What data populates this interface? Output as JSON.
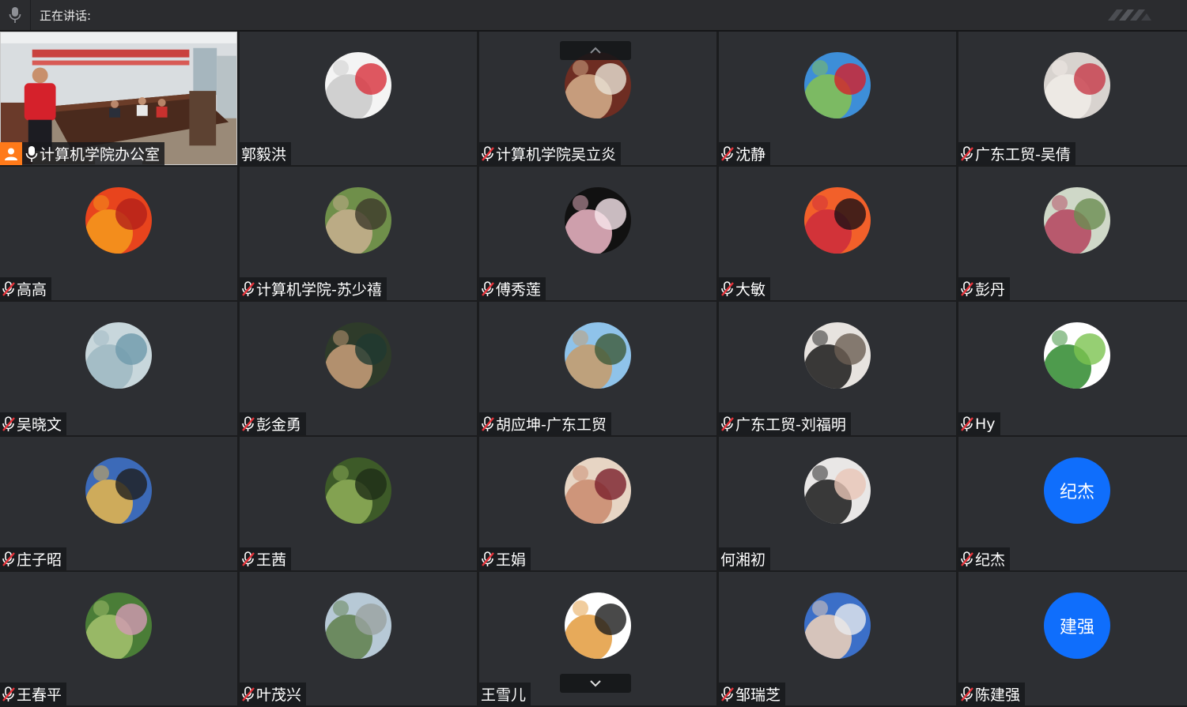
{
  "topbar": {
    "speaking_label": "正在讲话:",
    "mic_icon": "microphone-icon"
  },
  "participants": [
    {
      "name": "计算机学院办公室",
      "type": "video",
      "host": true,
      "mic": "on"
    },
    {
      "name": "郭毅洪",
      "type": "avatar",
      "mic": "none",
      "colors": [
        "#f4f4f4",
        "#c9c9c9",
        "#d8303b"
      ]
    },
    {
      "name": "计算机学院吴立炎",
      "type": "avatar",
      "mic": "muted",
      "colors": [
        "#6e2d22",
        "#d6b08c",
        "#e9e2d6"
      ]
    },
    {
      "name": "沈静",
      "type": "avatar",
      "mic": "muted",
      "colors": [
        "#3d8ed8",
        "#87c24f",
        "#d5202a"
      ]
    },
    {
      "name": "广东工贸-吴倩",
      "type": "avatar",
      "mic": "muted",
      "colors": [
        "#d8d3cf",
        "#f1ece8",
        "#c73a47"
      ]
    },
    {
      "name": "高高",
      "type": "avatar",
      "mic": "muted",
      "colors": [
        "#e8441d",
        "#f59a1c",
        "#b3201a"
      ]
    },
    {
      "name": "计算机学院-苏少禧",
      "type": "avatar",
      "mic": "muted",
      "colors": [
        "#6f8f4a",
        "#c9b08f",
        "#3d3a2a"
      ]
    },
    {
      "name": "傅秀莲",
      "type": "avatar",
      "mic": "muted",
      "colors": [
        "#111111",
        "#f0b8c8",
        "#f7e6ec"
      ]
    },
    {
      "name": "大敏",
      "type": "avatar",
      "mic": "muted",
      "colors": [
        "#f2602a",
        "#cd2b3c",
        "#1b1015"
      ]
    },
    {
      "name": "彭丹",
      "type": "avatar",
      "mic": "muted",
      "colors": [
        "#cfd8c8",
        "#b4435d",
        "#6a8d51"
      ]
    },
    {
      "name": "吴晓文",
      "type": "avatar",
      "mic": "muted",
      "colors": [
        "#c8d7dc",
        "#9eb8c2",
        "#6e9aab"
      ]
    },
    {
      "name": "彭金勇",
      "type": "avatar",
      "mic": "muted",
      "colors": [
        "#2e3b2a",
        "#c9a07a",
        "#1f3a31"
      ]
    },
    {
      "name": "胡应坤-广东工贸",
      "type": "avatar",
      "mic": "muted",
      "colors": [
        "#8fc3ea",
        "#c79b69",
        "#3d5a38"
      ]
    },
    {
      "name": "广东工贸-刘福明",
      "type": "avatar",
      "mic": "muted",
      "colors": [
        "#e7e3df",
        "#1a1a1a",
        "#6b5e52"
      ]
    },
    {
      "name": "Hy",
      "type": "avatar",
      "mic": "muted",
      "colors": [
        "#ffffff",
        "#2f8a2e",
        "#7cc350"
      ]
    },
    {
      "name": "庄子昭",
      "type": "avatar",
      "mic": "muted",
      "colors": [
        "#3c6ab8",
        "#e7b64a",
        "#1e1e1e"
      ]
    },
    {
      "name": "王茜",
      "type": "avatar",
      "mic": "muted",
      "colors": [
        "#3d5a28",
        "#8faf58",
        "#1e2d16"
      ]
    },
    {
      "name": "王娟",
      "type": "avatar",
      "mic": "muted",
      "colors": [
        "#e7d5c4",
        "#c98a6d",
        "#7a1f2c"
      ]
    },
    {
      "name": "何湘初",
      "type": "avatar",
      "mic": "none",
      "colors": [
        "#e9e7e6",
        "#1a1a1a",
        "#e9c6b7"
      ]
    },
    {
      "name": "纪杰",
      "type": "text",
      "avatar_text": "纪杰",
      "mic": "muted"
    },
    {
      "name": "王春平",
      "type": "avatar",
      "mic": "muted",
      "colors": [
        "#4a7d37",
        "#a6c26e",
        "#d39ab4"
      ]
    },
    {
      "name": "叶茂兴",
      "type": "avatar",
      "mic": "muted",
      "colors": [
        "#b7c9d6",
        "#5f7f4b",
        "#9aa3a0"
      ]
    },
    {
      "name": "王雪儿",
      "type": "avatar",
      "mic": "none",
      "colors": [
        "#ffffff",
        "#e39b3d",
        "#1b1b1b"
      ]
    },
    {
      "name": "邹瑞芝",
      "type": "avatar",
      "mic": "muted",
      "colors": [
        "#3b6fc8",
        "#f2d3b8",
        "#e8ebef"
      ]
    },
    {
      "name": "陈建强",
      "type": "text",
      "avatar_text": "建强",
      "mic": "muted"
    }
  ],
  "navigation": {
    "up_icon": "chevron-up-icon",
    "down_icon": "chevron-down-icon"
  },
  "colors": {
    "background": "#1b1c1e",
    "tile": "#2d2f33",
    "host_badge": "#ff7a1a",
    "text_avatar": "#0f6efc",
    "mute_red": "#e8323a"
  }
}
